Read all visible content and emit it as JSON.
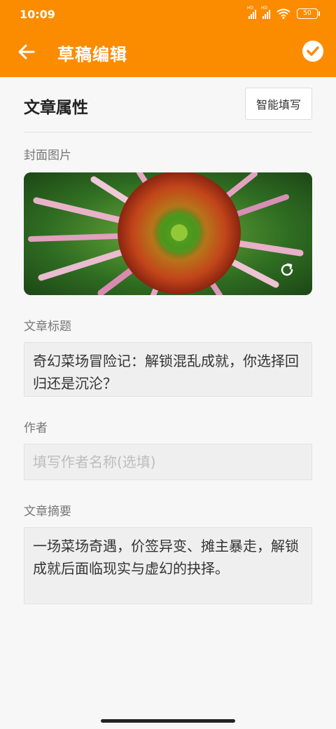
{
  "status_bar": {
    "time": "10:09",
    "battery": "50",
    "signal_tag": "HD"
  },
  "app_bar": {
    "title": "草稿编辑"
  },
  "section": {
    "title": "文章属性",
    "smart_fill_label": "智能填写"
  },
  "cover": {
    "label": "封面图片"
  },
  "article_title": {
    "label": "文章标题",
    "value": "奇幻菜场冒险记：解锁混乱成就，你选择回归还是沉沦？"
  },
  "author": {
    "label": "作者",
    "placeholder": "填写作者名称(选填)",
    "value": ""
  },
  "summary": {
    "label": "文章摘要",
    "value": "一场菜场奇遇，价签异变、摊主暴走，解锁成就后面临现实与虚幻的抉择。"
  },
  "colors": {
    "accent": "#fb8c00",
    "background": "#f7f7f7"
  },
  "icons": [
    "back-arrow-icon",
    "check-circle-icon",
    "refresh-icon",
    "wifi-icon",
    "signal-icon",
    "battery-icon"
  ]
}
